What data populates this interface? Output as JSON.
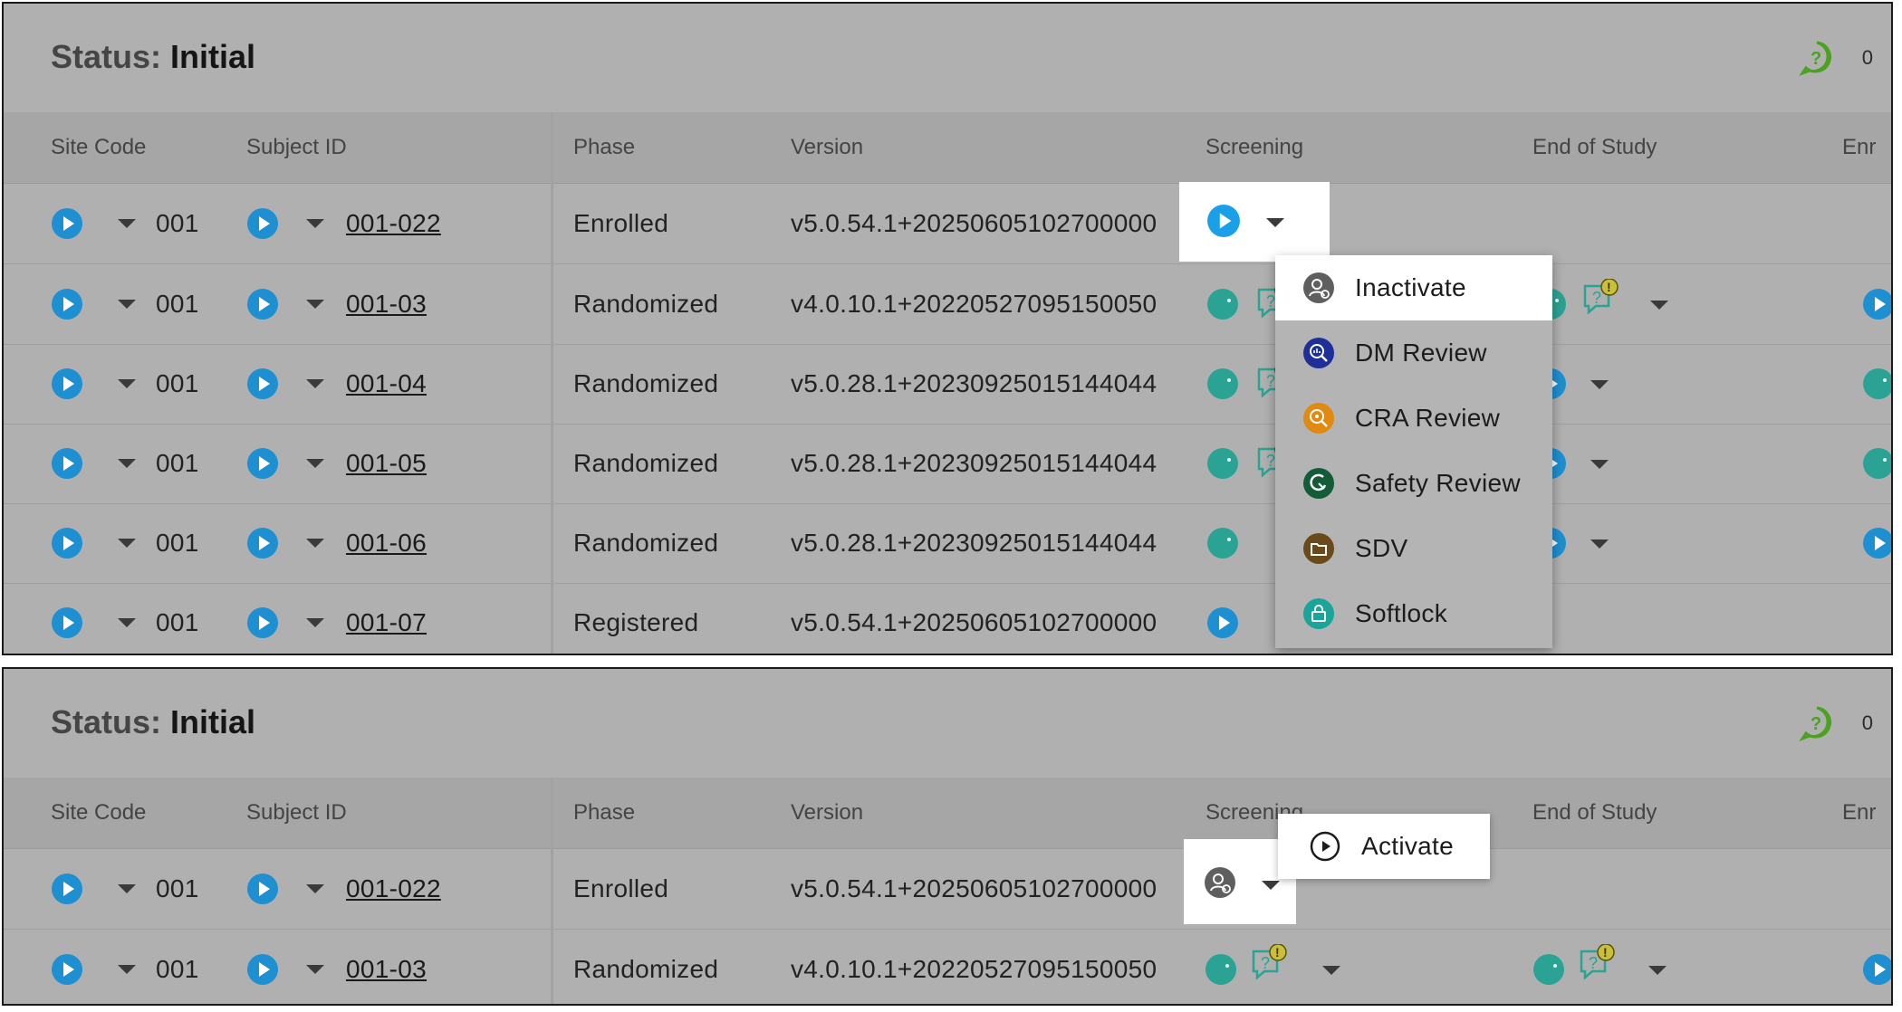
{
  "status": {
    "label": "Status:",
    "value": "Initial",
    "comment_count": "0"
  },
  "columns": {
    "site_code": "Site Code",
    "subject_id": "Subject ID",
    "phase": "Phase",
    "version": "Version",
    "screening": "Screening",
    "end_of_study": "End of Study",
    "enr": "Enr"
  },
  "top_rows": [
    {
      "site": "001",
      "subject": "001-022",
      "phase": "Enrolled",
      "version": "v5.0.54.1+20250605102700000"
    },
    {
      "site": "001",
      "subject": "001-03",
      "phase": "Randomized",
      "version": "v4.0.10.1+20220527095150050"
    },
    {
      "site": "001",
      "subject": "001-04",
      "phase": "Randomized",
      "version": "v5.0.28.1+20230925015144044"
    },
    {
      "site": "001",
      "subject": "001-05",
      "phase": "Randomized",
      "version": "v5.0.28.1+20230925015144044"
    },
    {
      "site": "001",
      "subject": "001-06",
      "phase": "Randomized",
      "version": "v5.0.28.1+20230925015144044"
    },
    {
      "site": "001",
      "subject": "001-07",
      "phase": "Registered",
      "version": "v5.0.54.1+20250605102700000"
    }
  ],
  "bottom_rows": [
    {
      "site": "001",
      "subject": "001-022",
      "phase": "Enrolled",
      "version": "v5.0.54.1+20250605102700000"
    },
    {
      "site": "001",
      "subject": "001-03",
      "phase": "Randomized",
      "version": "v4.0.10.1+20220527095150050"
    }
  ],
  "menu": {
    "items": [
      {
        "label": "Inactivate",
        "icon": "inactivate-icon",
        "color": "#5f5f5f"
      },
      {
        "label": "DM Review",
        "icon": "dm-review-icon",
        "color": "#1f2f9a"
      },
      {
        "label": "CRA Review",
        "icon": "cra-review-icon",
        "color": "#e08a12"
      },
      {
        "label": "Safety Review",
        "icon": "safety-review-icon",
        "color": "#135c38"
      },
      {
        "label": "SDV",
        "icon": "sdv-icon",
        "color": "#6b4a1a"
      },
      {
        "label": "Softlock",
        "icon": "softlock-icon",
        "color": "#1aa59a"
      }
    ]
  },
  "activate_popup": {
    "label": "Activate",
    "icon": "activate-icon"
  },
  "colors": {
    "play": "#1e8fd0",
    "play_bright": "#1aa0e8",
    "teal_status": "#2aa394",
    "comment_green": "#4aa21e"
  }
}
